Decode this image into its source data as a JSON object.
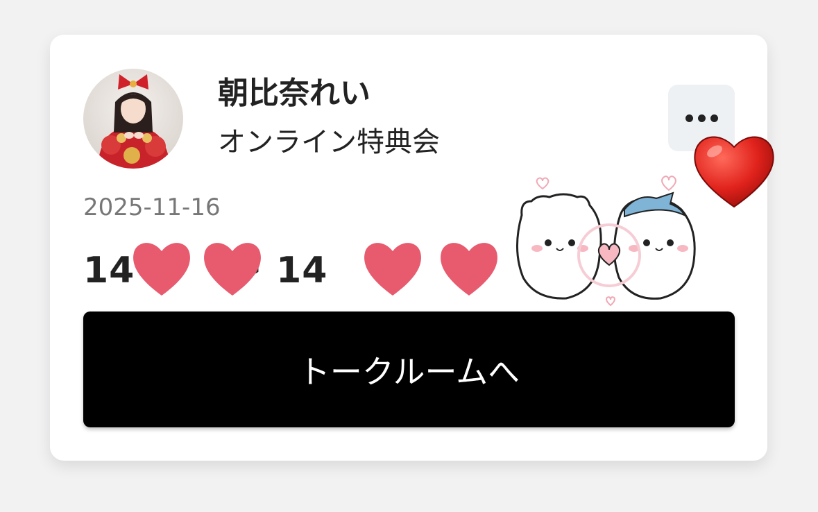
{
  "event": {
    "name": "朝比奈れい",
    "subtitle": "オンライン特典会",
    "date": "2025-11-16",
    "time_visible": "14  :   ~ 14  :  ",
    "time_start_prefix": "14",
    "time_end_prefix": "14",
    "time_separator": "~"
  },
  "actions": {
    "more_icon": "ellipsis-icon",
    "talk_room_label": "トークルームへ"
  },
  "stickers": {
    "redaction": "heart-sticker",
    "characters": "bear-characters-sticker",
    "decoration": "red-heart-emoji"
  },
  "colors": {
    "button_bg": "#000000",
    "button_text": "#ffffff",
    "heart_pink": "#e85a6e",
    "heart_red": "#e0221c",
    "more_bg": "#eef1f4"
  }
}
